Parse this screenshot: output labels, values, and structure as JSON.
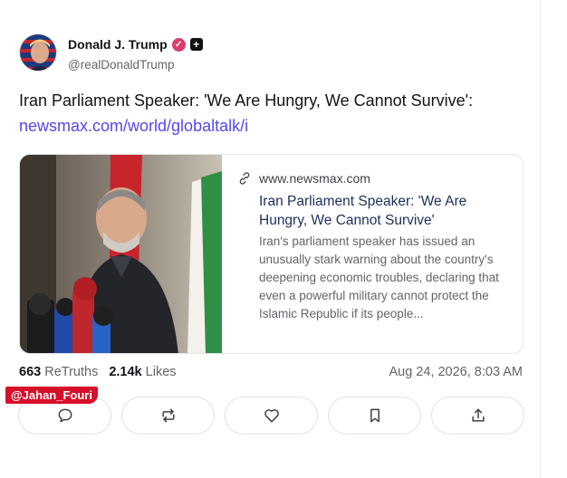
{
  "author": {
    "display_name": "Donald J. Trump",
    "handle": "@realDonaldTrump",
    "verified_icon": "check",
    "badge_icon": "plus"
  },
  "post": {
    "text": "Iran Parliament Speaker: 'We Are Hungry, We Cannot Survive':",
    "link_text": "newsmax.com/world/globaltalk/i"
  },
  "preview": {
    "domain": "www.newsmax.com",
    "title": "Iran Parliament Speaker: 'We Are Hungry, We Cannot Survive'",
    "description": "Iran's parliament speaker has issued an unusually stark warning about the country's deepening economic troubles, declaring that even a powerful military cannot protect the Islamic Republic if its people..."
  },
  "stats": {
    "retruths_count": "663",
    "retruths_label": "ReTruths",
    "likes_count": "2.14k",
    "likes_label": "Likes",
    "timestamp": "Aug 24, 2026, 8:03 AM"
  },
  "watermark": "@Jahan_Fouri",
  "actions": [
    "reply-icon",
    "retruth-icon",
    "like-icon",
    "bookmark-icon",
    "share-icon"
  ],
  "colors": {
    "link": "#5448ee",
    "verified": "#d93f6e",
    "watermark_bg": "#d7102a"
  }
}
